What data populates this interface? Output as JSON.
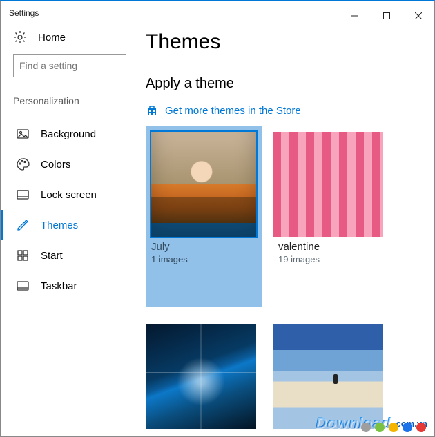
{
  "window": {
    "title": "Settings"
  },
  "sidebar": {
    "home_label": "Home",
    "search_placeholder": "Find a setting",
    "section_label": "Personalization",
    "items": [
      {
        "label": "Background",
        "icon": "picture-icon",
        "active": false
      },
      {
        "label": "Colors",
        "icon": "palette-icon",
        "active": false
      },
      {
        "label": "Lock screen",
        "icon": "lockscreen-icon",
        "active": false
      },
      {
        "label": "Themes",
        "icon": "pen-icon",
        "active": true
      },
      {
        "label": "Start",
        "icon": "start-icon",
        "active": false
      },
      {
        "label": "Taskbar",
        "icon": "taskbar-icon",
        "active": false
      }
    ]
  },
  "main": {
    "title": "Themes",
    "apply_label": "Apply a theme",
    "store_link": "Get more themes in the Store",
    "themes": [
      {
        "name": "July",
        "count_label": "1 images",
        "thumb": "july",
        "selected": true
      },
      {
        "name": "valentine",
        "count_label": "19 images",
        "thumb": "valentine",
        "selected": false
      },
      {
        "name": "",
        "count_label": "",
        "thumb": "windows",
        "selected": false
      },
      {
        "name": "",
        "count_label": "",
        "thumb": "beach",
        "selected": false
      }
    ]
  },
  "watermark": {
    "text": "Download",
    "ext": ".com.vn",
    "dot_colors": [
      "#9e9e9e",
      "#7cc242",
      "#f4b400",
      "#1a73e8",
      "#e53935"
    ]
  }
}
